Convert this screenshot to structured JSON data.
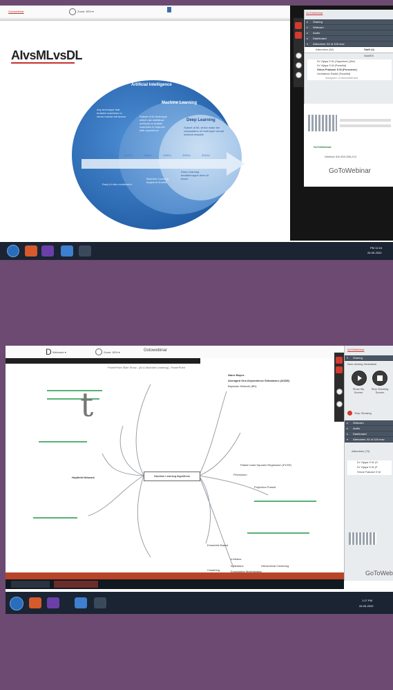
{
  "shot1": {
    "toolbar": {
      "left_text": "Gotowebinar",
      "zoom": "Zoom: 50% ▾",
      "right_text": "GoToWebinar"
    },
    "slide": {
      "title": "AIvsMLvsDL",
      "ai_label": "Artificial Intelligence",
      "ml_label": "Machine Learning",
      "dl_label": "Deep Learning",
      "ai_desc": "Any technique that enables machines to mimic human behaviour",
      "ml_desc": "Subset of AI technique which use statistical methods to enable machines to improve with experience",
      "dl_desc": "Subset of ML which make the computation of multi-layer neural network feasible",
      "timeline": [
        "1950's",
        "1960's",
        "1970's",
        "1980's",
        "1990's",
        "2000's",
        "2010's"
      ],
      "early_ai": "Early AI stirs excitement",
      "ml_flourish": "Machine Learning begins to flourish",
      "dl_breakthrough": "Deep Learning breakthroughs drive AI boom"
    },
    "panel": {
      "sections": [
        "Sharing",
        "Webcam",
        "Audio",
        "Dashboard",
        "Attendees: 82 of 100 max"
      ],
      "tabs": [
        "Attendees (82)",
        "Staff (4)"
      ],
      "col_header": "NAMES",
      "staff": [
        "Dr Vijaya S M (Organizer) (Me)",
        "Dr Vijaya S M (Panelist)",
        "Shiva Prakash S M (Presenter)",
        "Venkatesh Raddi (Panelist)"
      ],
      "note": "Assigned: Unmuted/Muted",
      "brand": "GoToWebinar",
      "id_line": "Webinar ID# 853-356-219"
    },
    "taskbar": {
      "time": "PM 12:24",
      "date": "26-05-2020"
    }
  },
  "shot2": {
    "toolbar": {
      "left": "Welcome ▾",
      "zoom": "Zoom: 50% ▾",
      "right": "Gotowebinar"
    },
    "ppt_title": "PowerPoint Slide Show - [AI & Machine Learning] - PowerPoint",
    "mindmap": {
      "center": "Machine Learning Algorithms",
      "nodes": [
        "Hopfield Network",
        "Ensemble Based",
        "Clustering",
        "k-Means",
        "k-Medians",
        "Hierarchical Clustering",
        "Expectation Maximisation",
        "Perceptron",
        "Projection Pursuit",
        "Partial Least Squares Regression (PLSR)",
        "Averaged One-Dependence Estimators (AODE)",
        "Naive Bayes",
        "Bayesian Network (BN)"
      ]
    },
    "panel": {
      "brand": "GoToWebinar",
      "presenter": "Now viewing Venkatesh",
      "share_buttons": [
        "Show My Screen",
        "Stop Showing Screen"
      ],
      "stop_label": "Stop Showing",
      "sections": [
        "Webcam",
        "Audio",
        "Dashboard",
        "Attendees: 82 of 100 max"
      ],
      "tab": "Attendees (79)",
      "staff": [
        "Dr Vijaya S M (O",
        "Dr Vijaya S M (P",
        "Shiva Prakash S M"
      ]
    },
    "taskbar": {
      "time": "1:17 PM",
      "date": "26-05-2020"
    }
  },
  "colors": {
    "slide_blue": "#2f6fb6",
    "slide_light": "#d9e7f5",
    "accent_red": "#d43a2f",
    "panel_header": "#4a5563"
  }
}
